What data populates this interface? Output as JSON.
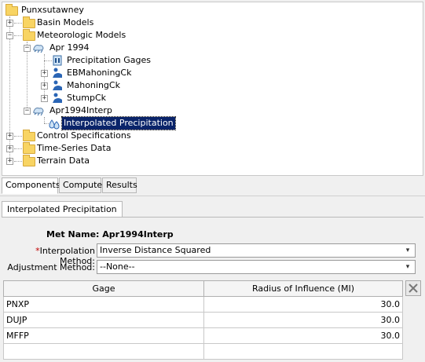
{
  "tree": {
    "root": "Punxsutawney",
    "basin_models": "Basin Models",
    "meteorologic_models": "Meteorologic Models",
    "met_1": "Apr 1994",
    "precip_gages": "Precipitation Gages",
    "sub_1": "EBMahoningCk",
    "sub_2": "MahoningCk",
    "sub_3": "StumpCk",
    "met_2": "Apr1994Interp",
    "interp": "Interpolated Precipitation",
    "control": "Control Specifications",
    "timeseries": "Time-Series Data",
    "terrain": "Terrain Data"
  },
  "bottom_tabs": [
    "Components",
    "Compute",
    "Results"
  ],
  "component_tab": "Interpolated Precipitation",
  "form": {
    "met_name_label": "Met Name:",
    "met_name_value": "Apr1994Interp",
    "required_mark": "*",
    "interp_label": "Interpolation Method:",
    "interp_value": "Inverse Distance Squared",
    "adjust_label": "Adjustment Method:",
    "adjust_value": "--None--"
  },
  "table": {
    "headers": [
      "Gage",
      "Radius of Influence (MI)"
    ],
    "rows": [
      [
        "PNXP",
        "30.0"
      ],
      [
        "DUJP",
        "30.0"
      ],
      [
        "MFFP",
        "30.0"
      ],
      [
        "",
        ""
      ]
    ]
  }
}
